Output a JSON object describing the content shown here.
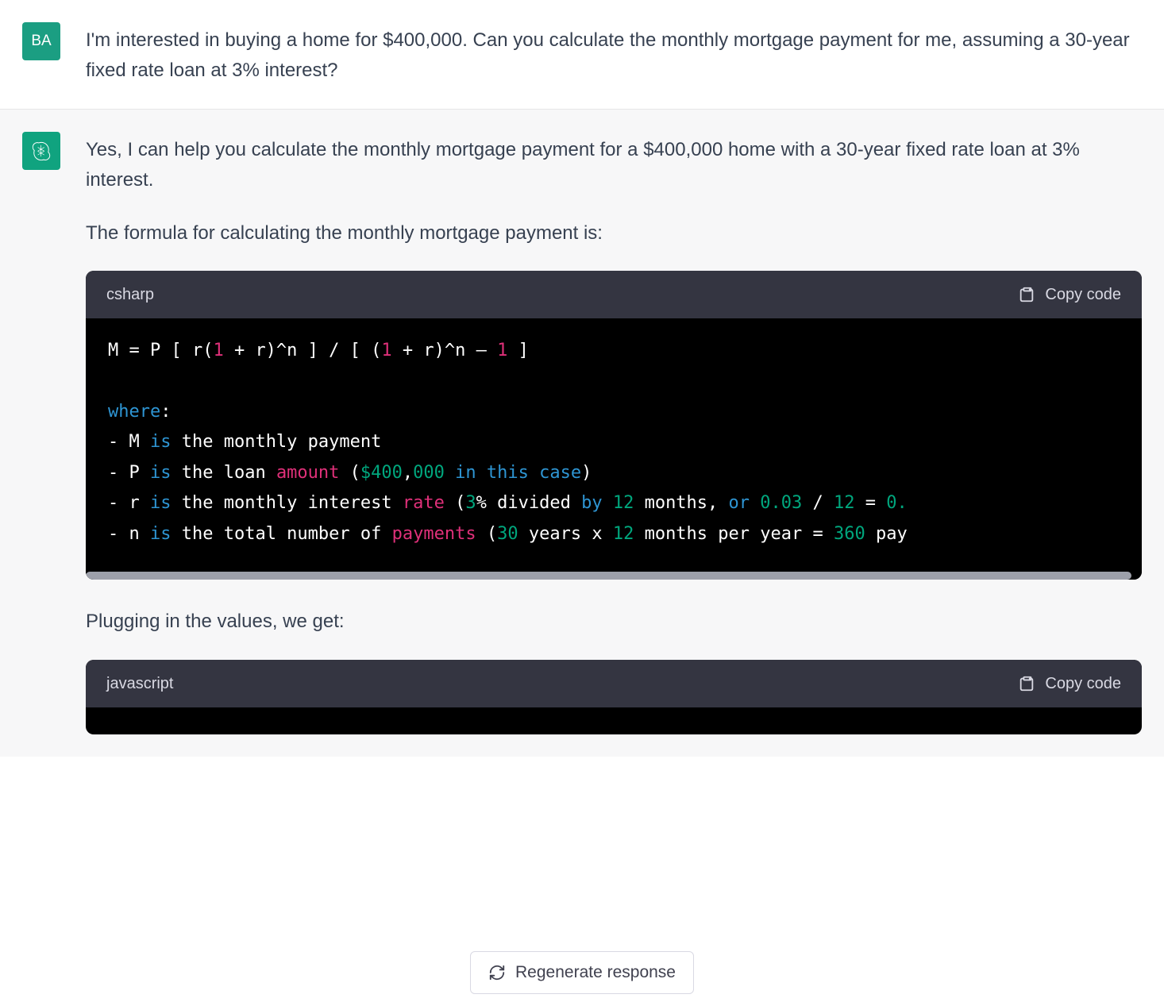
{
  "user": {
    "avatar_initials": "BA",
    "message": "I'm interested in buying a home for $400,000. Can you calculate the monthly mortgage payment for me, assuming a 30-year fixed rate loan at 3% interest?"
  },
  "assistant": {
    "intro_p1": "Yes, I can help you calculate the monthly mortgage payment for a $400,000 home with a 30-year fixed rate loan at 3% interest.",
    "intro_p2": "The formula for calculating the monthly mortgage payment is:",
    "code1": {
      "language": "csharp",
      "copy_label": "Copy code",
      "formula": {
        "pre": "M = P [ r(",
        "n1": "1",
        "mid1": " + r)^n ] / [ (",
        "n2": "1",
        "mid2": " + r)^n – ",
        "n3": "1",
        "end": " ]"
      },
      "where_label": "where",
      "colon": ":",
      "l1": {
        "dash_sym": "- M ",
        "is": "is",
        "rest": " the monthly payment"
      },
      "l2": {
        "dash_sym": "- P ",
        "is": "is",
        "rest_a": " the loan ",
        "amount": "amount",
        "sp": " ",
        "paren_open": "(",
        "dollar": "$400",
        "comma": ",",
        "zeros": "000",
        "sp2": " ",
        "in_kw": "in",
        "sp3": " ",
        "this_kw": "this",
        "sp4": " ",
        "case_kw": "case",
        "paren_close": ")"
      },
      "l3": {
        "dash_sym": "- r ",
        "is": "is",
        "rest_a": " the monthly interest ",
        "rate": "rate",
        "sp": " ",
        "paren_open": "(",
        "three": "3",
        "pct": "% divided ",
        "by": "by",
        "sp2": " ",
        "twelve": "12",
        "sp3": " months, ",
        "or": "or",
        "sp4": " ",
        "v003": "0.03",
        "sp5": " / ",
        "twelve2": "12",
        "sp6": " = ",
        "zero": "0."
      },
      "l4": {
        "dash_sym": "- n ",
        "is": "is",
        "rest_a": " the total number of ",
        "payments": "payments",
        "sp": " ",
        "paren_open": "(",
        "thirty": "30",
        "sp2": " years x ",
        "twelve": "12",
        "sp3": " months per year = ",
        "v360": "360",
        "sp4": " pay"
      }
    },
    "mid_p": "Plugging in the values, we get:",
    "code2": {
      "language": "javascript",
      "copy_label": "Copy code"
    }
  },
  "controls": {
    "regenerate_label": "Regenerate response"
  }
}
